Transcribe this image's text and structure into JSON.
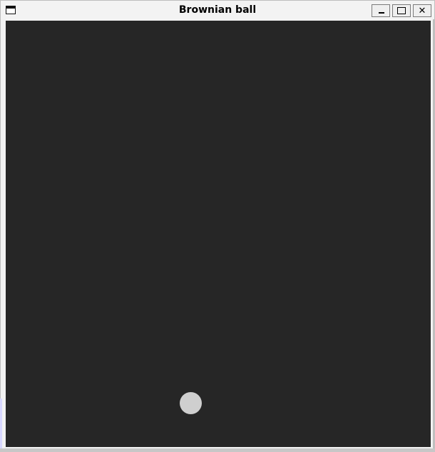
{
  "window": {
    "title": "Brownian ball",
    "controls": {
      "minimize": "minimize",
      "maximize": "maximize",
      "close": "✕"
    },
    "icons": {
      "window": "window-icon",
      "minimize": "minimize-icon",
      "maximize": "maximize-icon",
      "close": "close-icon"
    }
  },
  "canvas": {
    "background": "#262626",
    "ball_color": "#cfcfcf"
  }
}
